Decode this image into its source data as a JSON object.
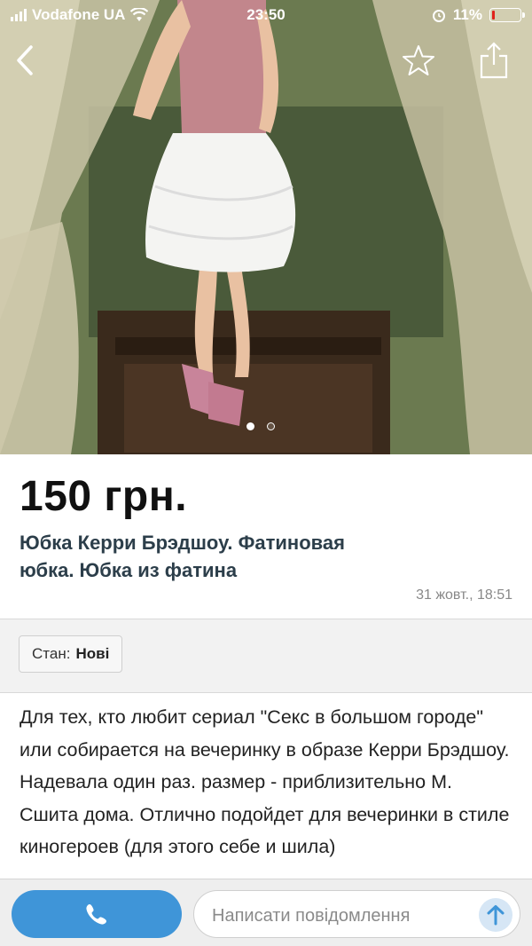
{
  "status_bar": {
    "carrier": "Vodafone UA",
    "time": "23:50",
    "battery": "11%",
    "icons": [
      "signal-icon",
      "wifi-icon",
      "alarm-icon",
      "battery-icon"
    ]
  },
  "navigation": {
    "back_icon": "chevron-left-icon",
    "favorite_icon": "star-outline-icon",
    "share_icon": "share-icon"
  },
  "gallery": {
    "image_description": "Photo of a white tulle skirt outfit",
    "dots_total": 2,
    "dots_active": 1
  },
  "listing": {
    "price": "150 грн.",
    "title": "Юбка Керри Брэдшоу. Фатиновая юбка. Юбка из фатина",
    "date": "31 жовт., 18:51",
    "condition_label": "Стан:",
    "condition_value": "Нові",
    "description": "Для тех, кто любит сериал \"Секс в большом городе\" или собирается на вечеринку в образе Керри Брэдшоу. Надевала один раз. размер - приблизительно М. Сшита дома. Отлично подойдет для вечеринки в стиле киногероев (для этого себе и шила)"
  },
  "bottom_bar": {
    "call_icon": "phone-icon",
    "message_placeholder": "Написати повідомлення",
    "send_icon": "arrow-up-icon"
  },
  "colors": {
    "accent": "#3f95d8",
    "send_button_bg": "#d6e6f5",
    "battery_low": "#e0231c",
    "title_text": "#2c3e4a"
  }
}
